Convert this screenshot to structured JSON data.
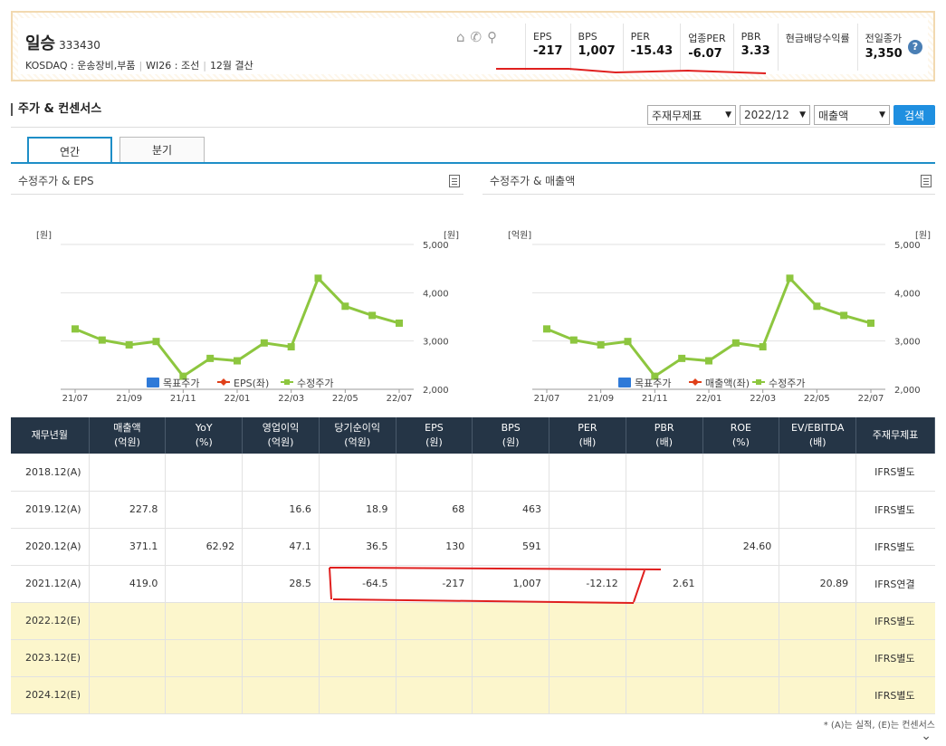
{
  "company": {
    "name": "일승",
    "code": "333430",
    "market": "KOSDAQ : 운송장비,부품",
    "wics": "WI26 : 조선",
    "settle": "12월 결산"
  },
  "stats": [
    {
      "label": "EPS",
      "value": "-217"
    },
    {
      "label": "BPS",
      "value": "1,007"
    },
    {
      "label": "PER",
      "value": "-15.43"
    },
    {
      "label": "업종PER",
      "value": "-6.07"
    },
    {
      "label": "PBR",
      "value": "3.33"
    },
    {
      "label": "현금배당수익률",
      "value": ""
    },
    {
      "label": "전일종가",
      "value": "3,350"
    }
  ],
  "section_title": "주가 & 컨센서스",
  "controls": {
    "select1": "주재무제표",
    "select2": "2022/12",
    "select3": "매출액",
    "search": "검색"
  },
  "tabs": [
    "연간",
    "분기"
  ],
  "charts": [
    {
      "title": "수정주가 & EPS",
      "left_unit": "[원]",
      "right_unit": "[원]",
      "legend": [
        "목표주가",
        "EPS(좌)",
        "수정주가"
      ]
    },
    {
      "title": "수정주가 & 매출액",
      "left_unit": "[억원]",
      "right_unit": "[원]",
      "legend": [
        "목표주가",
        "매출액(좌)",
        "수정주가"
      ]
    }
  ],
  "chart_data": [
    {
      "type": "line",
      "title": "수정주가 & EPS",
      "x": [
        "21/07",
        "21/08",
        "21/09",
        "21/10",
        "21/11",
        "21/12",
        "22/01",
        "22/02",
        "22/03",
        "22/04",
        "22/05",
        "22/06",
        "22/07"
      ],
      "x_ticks": [
        "21/07",
        "21/09",
        "21/11",
        "22/01",
        "22/03",
        "22/05",
        "22/07"
      ],
      "y_right_ticks": [
        "5,000",
        "4,000",
        "3,000",
        "2,000"
      ],
      "ylim_right": [
        2000,
        5000
      ],
      "series": [
        {
          "name": "수정주가",
          "values": [
            3250,
            3020,
            2920,
            2990,
            2270,
            2640,
            2590,
            2960,
            2880,
            4300,
            3720,
            3530,
            3370
          ],
          "color": "#8dc63f"
        }
      ]
    },
    {
      "type": "line",
      "title": "수정주가 & 매출액",
      "x": [
        "21/07",
        "21/08",
        "21/09",
        "21/10",
        "21/11",
        "21/12",
        "22/01",
        "22/02",
        "22/03",
        "22/04",
        "22/05",
        "22/06",
        "22/07"
      ],
      "x_ticks": [
        "21/07",
        "21/09",
        "21/11",
        "22/01",
        "22/03",
        "22/05",
        "22/07"
      ],
      "y_right_ticks": [
        "5,000",
        "4,000",
        "3,000",
        "2,000"
      ],
      "ylim_right": [
        2000,
        5000
      ],
      "series": [
        {
          "name": "수정주가",
          "values": [
            3250,
            3020,
            2920,
            2990,
            2270,
            2640,
            2590,
            2960,
            2880,
            4300,
            3720,
            3530,
            3370
          ],
          "color": "#8dc63f"
        }
      ]
    }
  ],
  "table": {
    "headers": [
      [
        "재무년월",
        ""
      ],
      [
        "매출액",
        "(억원)"
      ],
      [
        "YoY",
        "(%)"
      ],
      [
        "영업이익",
        "(억원)"
      ],
      [
        "당기순이익",
        "(억원)"
      ],
      [
        "EPS",
        "(원)"
      ],
      [
        "BPS",
        "(원)"
      ],
      [
        "PER",
        "(배)"
      ],
      [
        "PBR",
        "(배)"
      ],
      [
        "ROE",
        "(%)"
      ],
      [
        "EV/EBITDA",
        "(배)"
      ],
      [
        "주재무제표",
        ""
      ]
    ],
    "rows": [
      [
        "2018.12(A)",
        "",
        "",
        "",
        "",
        "",
        "",
        "",
        "",
        "",
        "",
        "IFRS별도"
      ],
      [
        "2019.12(A)",
        "227.8",
        "",
        "16.6",
        "18.9",
        "68",
        "463",
        "",
        "",
        "",
        "",
        "IFRS별도"
      ],
      [
        "2020.12(A)",
        "371.1",
        "62.92",
        "47.1",
        "36.5",
        "130",
        "591",
        "",
        "",
        "24.60",
        "",
        "IFRS별도"
      ],
      [
        "2021.12(A)",
        "419.0",
        "",
        "28.5",
        "-64.5",
        "-217",
        "1,007",
        "-12.12",
        "2.61",
        "",
        "20.89",
        "IFRS연결"
      ],
      [
        "2022.12(E)",
        "",
        "",
        "",
        "",
        "",
        "",
        "",
        "",
        "",
        "",
        "IFRS별도"
      ],
      [
        "2023.12(E)",
        "",
        "",
        "",
        "",
        "",
        "",
        "",
        "",
        "",
        "",
        "IFRS별도"
      ],
      [
        "2024.12(E)",
        "",
        "",
        "",
        "",
        "",
        "",
        "",
        "",
        "",
        "",
        "IFRS별도"
      ]
    ],
    "estimate_rows": [
      4,
      5,
      6
    ]
  },
  "footnote": "* (A)는 실적, (E)는 컨센서스"
}
